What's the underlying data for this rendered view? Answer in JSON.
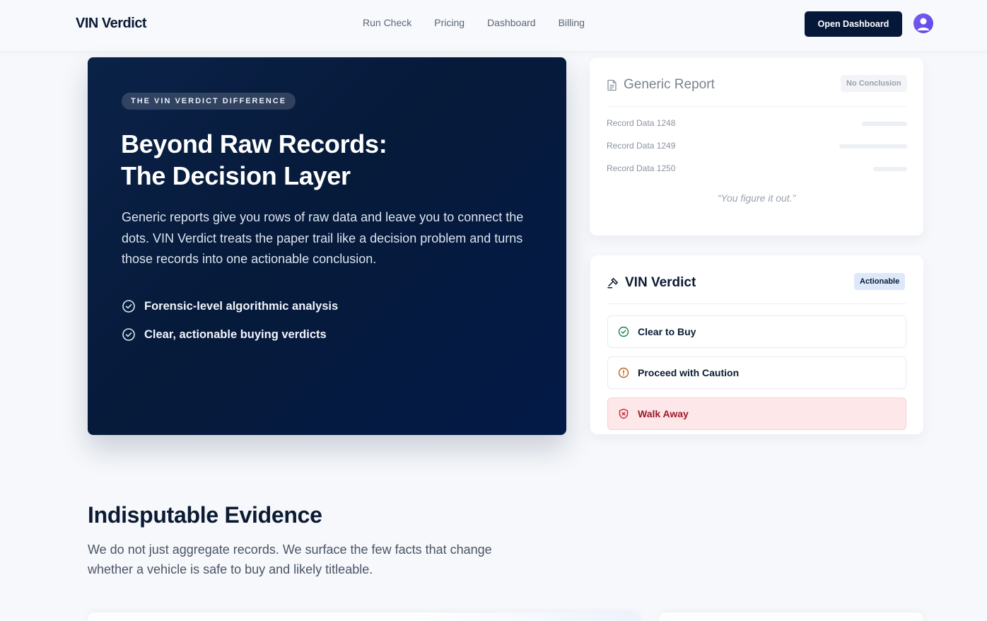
{
  "header": {
    "brand": "VIN Verdict",
    "nav": [
      "Run Check",
      "Pricing",
      "Dashboard",
      "Billing"
    ],
    "cta_label": "Open Dashboard",
    "avatar_icon": "user-avatar-icon"
  },
  "hero": {
    "eyebrow": "THE VIN VERDICT DIFFERENCE",
    "title_line1": "Beyond Raw Records:",
    "title_line2": "The Decision Layer",
    "description": "Generic reports give you rows of raw data and leave you to connect the dots. VIN Verdict treats the paper trail like a decision problem and turns those records into one actionable conclusion.",
    "bullets": [
      "Forensic-level algorithmic analysis",
      "Clear, actionable buying verdicts"
    ]
  },
  "generic_report": {
    "title": "Generic Report",
    "badge": "No Conclusion",
    "rows": [
      {
        "label": "Record Data 1248",
        "fill": 0.5
      },
      {
        "label": "Record Data 1249",
        "fill": 0.75
      },
      {
        "label": "Record Data 1250",
        "fill": 0.375
      }
    ],
    "quote": "“You figure it out.”"
  },
  "vin_verdict": {
    "title": "VIN Verdict",
    "badge": "Actionable",
    "options": [
      {
        "label": "Clear to Buy",
        "icon": "check-circle-icon",
        "color": "#1a7f52"
      },
      {
        "label": "Proceed with Caution",
        "icon": "alert-circle-icon",
        "color": "#b8651b"
      },
      {
        "label": "Walk Away",
        "icon": "shield-x-icon",
        "color": "#c0273a"
      }
    ]
  },
  "evidence": {
    "title": "Indisputable Evidence",
    "description": "We do not just aggregate records. We surface the few facts that change whether a vehicle is safe to buy and likely titleable."
  },
  "colors": {
    "navy": "#06183a",
    "accent_bg": "#dde9fb",
    "danger_bg": "#fde7e8"
  }
}
